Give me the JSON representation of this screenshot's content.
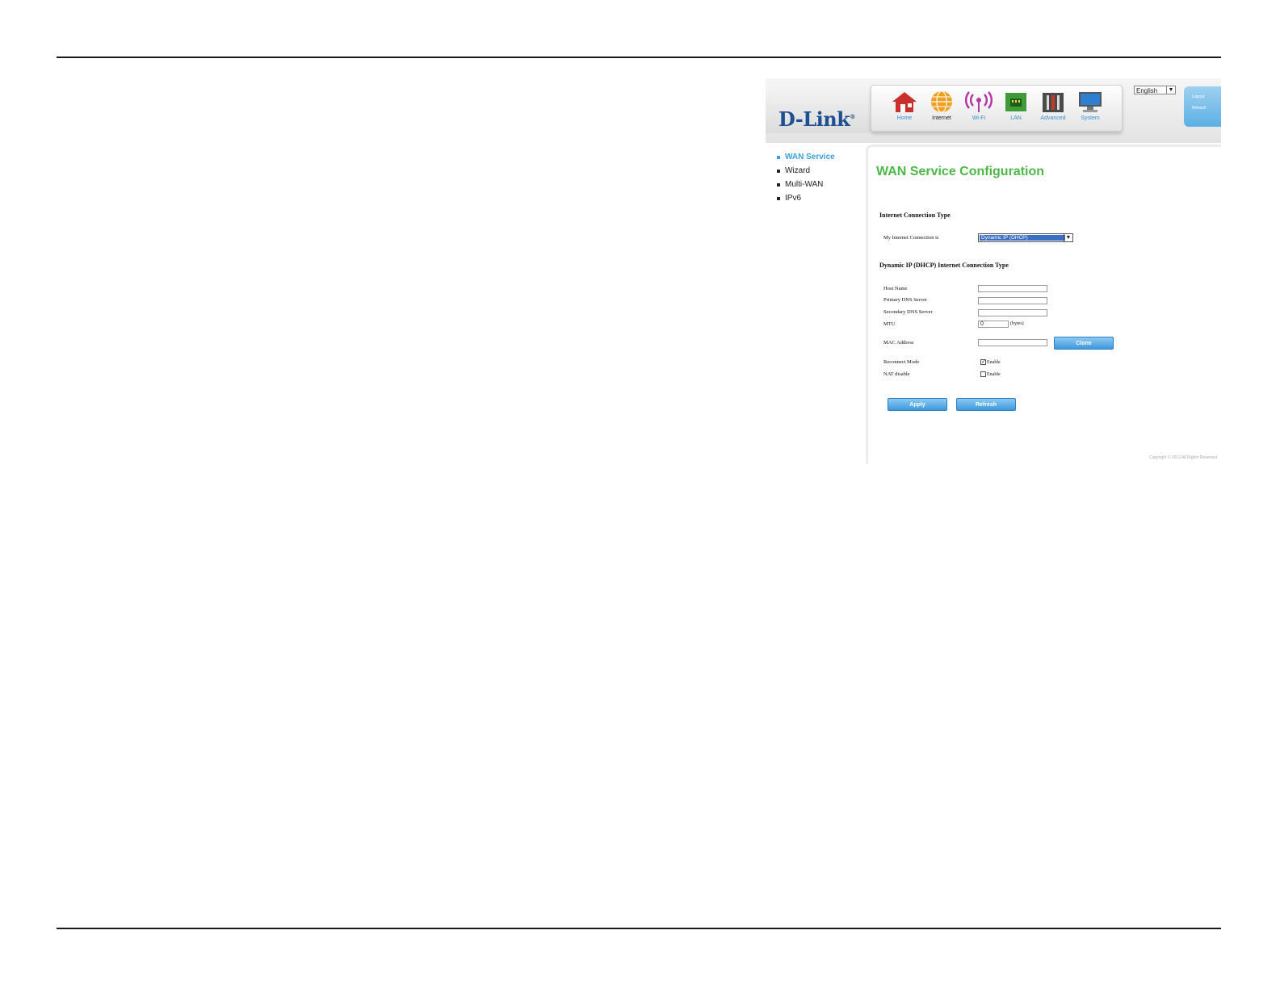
{
  "header": {
    "logo": "D-Link",
    "nav": [
      {
        "label": "Home",
        "icon": "home-icon"
      },
      {
        "label": "Internet",
        "icon": "globe-icon"
      },
      {
        "label": "Wi-Fi",
        "icon": "wifi-icon"
      },
      {
        "label": "LAN",
        "icon": "lan-icon"
      },
      {
        "label": "Advanced",
        "icon": "tools-icon"
      },
      {
        "label": "System",
        "icon": "monitor-icon"
      }
    ],
    "active_nav": "Internet",
    "language": "English",
    "side_links": [
      "Logout",
      "Refresh"
    ]
  },
  "sidebar": {
    "items": [
      "WAN Service",
      "Wizard",
      "Multi-WAN",
      "IPv6"
    ],
    "active": "WAN Service"
  },
  "main": {
    "title": "WAN Service Configuration",
    "connection_section": "Internet Connection Type",
    "connection_label": "My Internet Connection is",
    "connection_value": "Dynamic IP (DHCP)",
    "dhcp_section": "Dynamic IP (DHCP) Internet Connection Type",
    "fields": {
      "host_name": {
        "label": "Host Name",
        "value": ""
      },
      "primary_dns": {
        "label": "Primary DNS Server",
        "value": ""
      },
      "secondary_dns": {
        "label": "Secondary DNS Server",
        "value": ""
      },
      "mtu": {
        "label": "MTU",
        "value": "0",
        "suffix": "(bytes)"
      },
      "mac": {
        "label": "MAC Address",
        "value": ""
      }
    },
    "clone_label": "Clone",
    "reconnect": {
      "label": "Reconnect Mode",
      "option": "Enable",
      "checked": true
    },
    "nat": {
      "label": "NAT disable",
      "option": "Enable",
      "checked": false
    },
    "apply_label": "Apply",
    "refresh_label": "Refresh",
    "copyright": "Copyright © 2012 All Rights Reserved"
  },
  "colors": {
    "title_green": "#4cb848",
    "accent_blue": "#3aa0dc",
    "logo_blue": "#1d4f91"
  }
}
